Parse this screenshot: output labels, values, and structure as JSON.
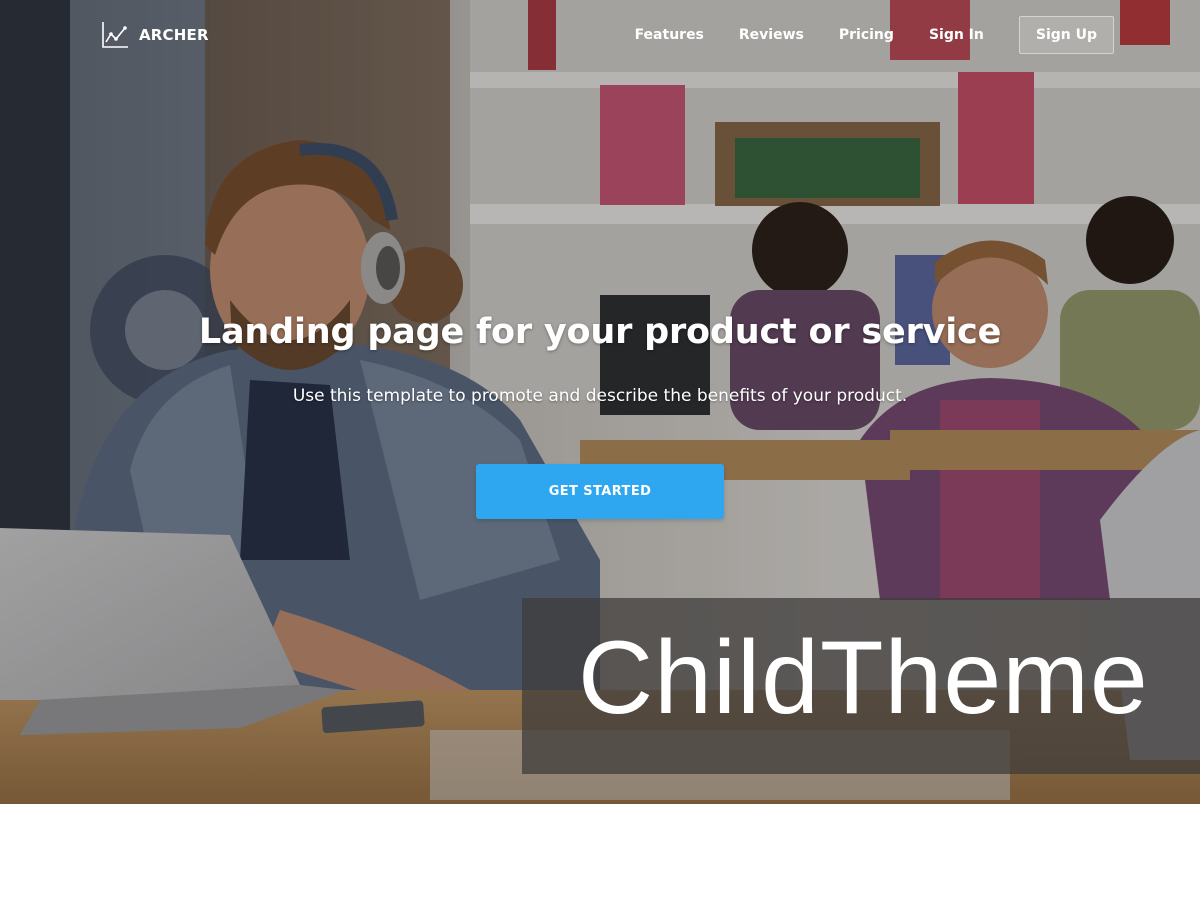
{
  "brand": {
    "name": "ARCHER",
    "logo_icon": "line-chart-icon"
  },
  "nav": {
    "items": [
      "Features",
      "Reviews",
      "Pricing",
      "Sign In"
    ],
    "signup_label": "Sign Up"
  },
  "hero": {
    "title": "Landing page for your product or service",
    "subtitle": "Use this template to promote and describe the benefits of your product.",
    "cta_label": "GET STARTED",
    "background_image": "office-workers-photo"
  },
  "banner": {
    "text": "ChildTheme"
  },
  "colors": {
    "cta": "#2ea6f0",
    "text_on_hero": "#ffffff",
    "banner_overlay": "#3e3c3a",
    "page_background": "#ffffff"
  }
}
